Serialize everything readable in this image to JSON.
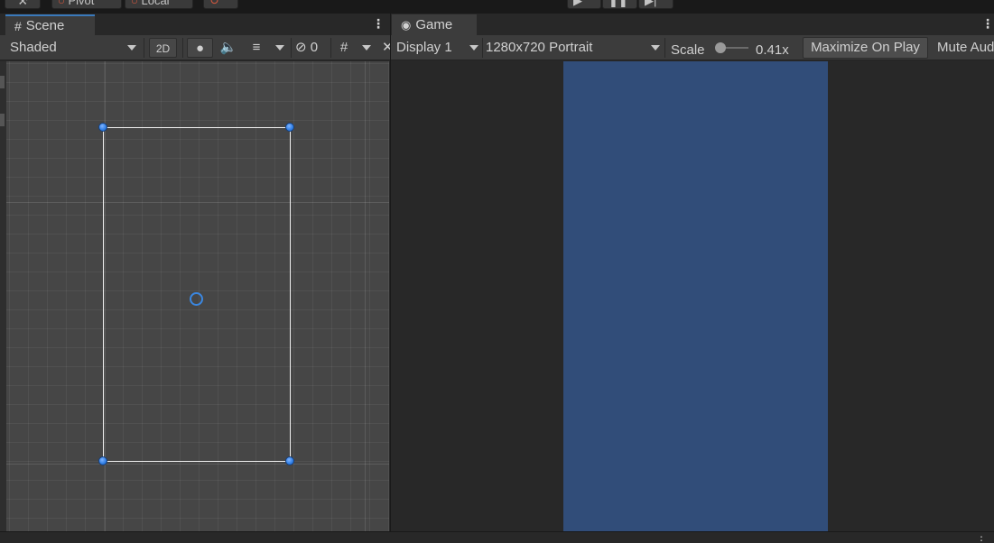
{
  "top_toolbar": {
    "tools_icon": "tools-icon",
    "pivot_label": "Pivot",
    "local_label": "Local",
    "snap_icon": "snap-icon",
    "play_icon": "play-icon",
    "pause_icon": "pause-icon",
    "step_icon": "step-icon"
  },
  "scene": {
    "tab_label": "Scene",
    "tab_icon": "grid-icon",
    "draw_mode": "Shaded",
    "mode_2d_label": "2D",
    "lighting_icon": "lightbulb-icon",
    "audio_icon": "speaker-icon",
    "effects_icon": "effects-icon",
    "hidden_count": "0",
    "hidden_icon": "eye-hidden-icon",
    "grid_icon": "grid-snap-icon",
    "tools_overflow_icon": "tools-icon"
  },
  "game": {
    "tab_label": "Game",
    "tab_icon": "gamepad-icon",
    "display": "Display 1",
    "resolution": "1280x720 Portrait",
    "scale_label": "Scale",
    "scale_value": "0.41x",
    "maximize_label": "Maximize On Play",
    "mute_label": "Mute Audio",
    "canvas_color": "#314d79"
  },
  "colors": {
    "accent": "#3a79bb",
    "handle": "#2f7ee6",
    "scene_bg": "#464646",
    "game_bg": "#282828"
  }
}
